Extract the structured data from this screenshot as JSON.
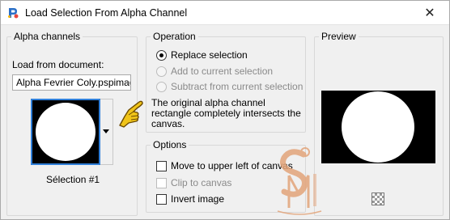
{
  "window": {
    "title": "Load Selection From Alpha Channel",
    "close_glyph": "✕"
  },
  "alpha_channels": {
    "group_title": "Alpha channels",
    "load_label": "Load from document:",
    "document_value": "Alpha Fevrier Coly.pspimage",
    "selected_channel": "Sélection #1"
  },
  "operation": {
    "group_title": "Operation",
    "options": [
      {
        "label": "Replace selection",
        "checked": true,
        "enabled": true
      },
      {
        "label": "Add to current selection",
        "checked": false,
        "enabled": false
      },
      {
        "label": "Subtract from current selection",
        "checked": false,
        "enabled": false
      }
    ],
    "info_text": "The original alpha channel rectangle completely intersects the canvas."
  },
  "options": {
    "group_title": "Options",
    "checkboxes": [
      {
        "label": "Move to upper left of canvas",
        "checked": false,
        "enabled": true
      },
      {
        "label": "Clip to canvas",
        "checked": false,
        "enabled": false
      },
      {
        "label": "Invert image",
        "checked": false,
        "enabled": true
      }
    ]
  },
  "preview": {
    "group_title": "Preview"
  },
  "icons": {
    "app": "psp-app-icon",
    "pointer": "pointing-hand-icon",
    "watermark": "sm-logo-watermark",
    "transparency": "checkerboard-icon"
  },
  "colors": {
    "thumb_border": "#2f7fd9",
    "watermark": "#e3a47a",
    "hand": "#f0c419"
  }
}
